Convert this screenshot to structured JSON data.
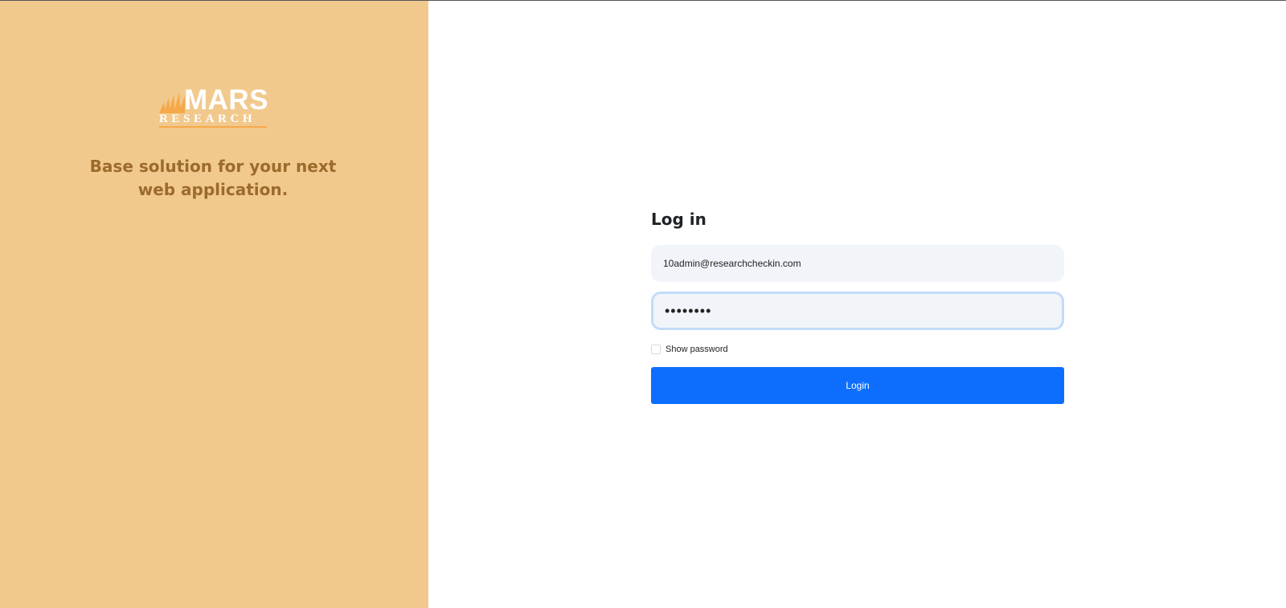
{
  "brand": {
    "logo_top": "MARS",
    "logo_bottom": "RESEARCH",
    "tagline": "Base solution for your next web application."
  },
  "login": {
    "title": "Log in",
    "email_value": "10admin@researchcheckin.com",
    "password_value": "••••••••",
    "show_password_label": "Show password",
    "show_password_checked": false,
    "submit_label": "Login"
  },
  "colors": {
    "left_panel": "#f2c98d",
    "tagline": "#9b6b2c",
    "button": "#0d6efd",
    "input_bg": "#f1f4f8",
    "focus_ring": "#c3dbf8"
  },
  "icons": {
    "logo_mark": "flame-stripes-icon"
  }
}
